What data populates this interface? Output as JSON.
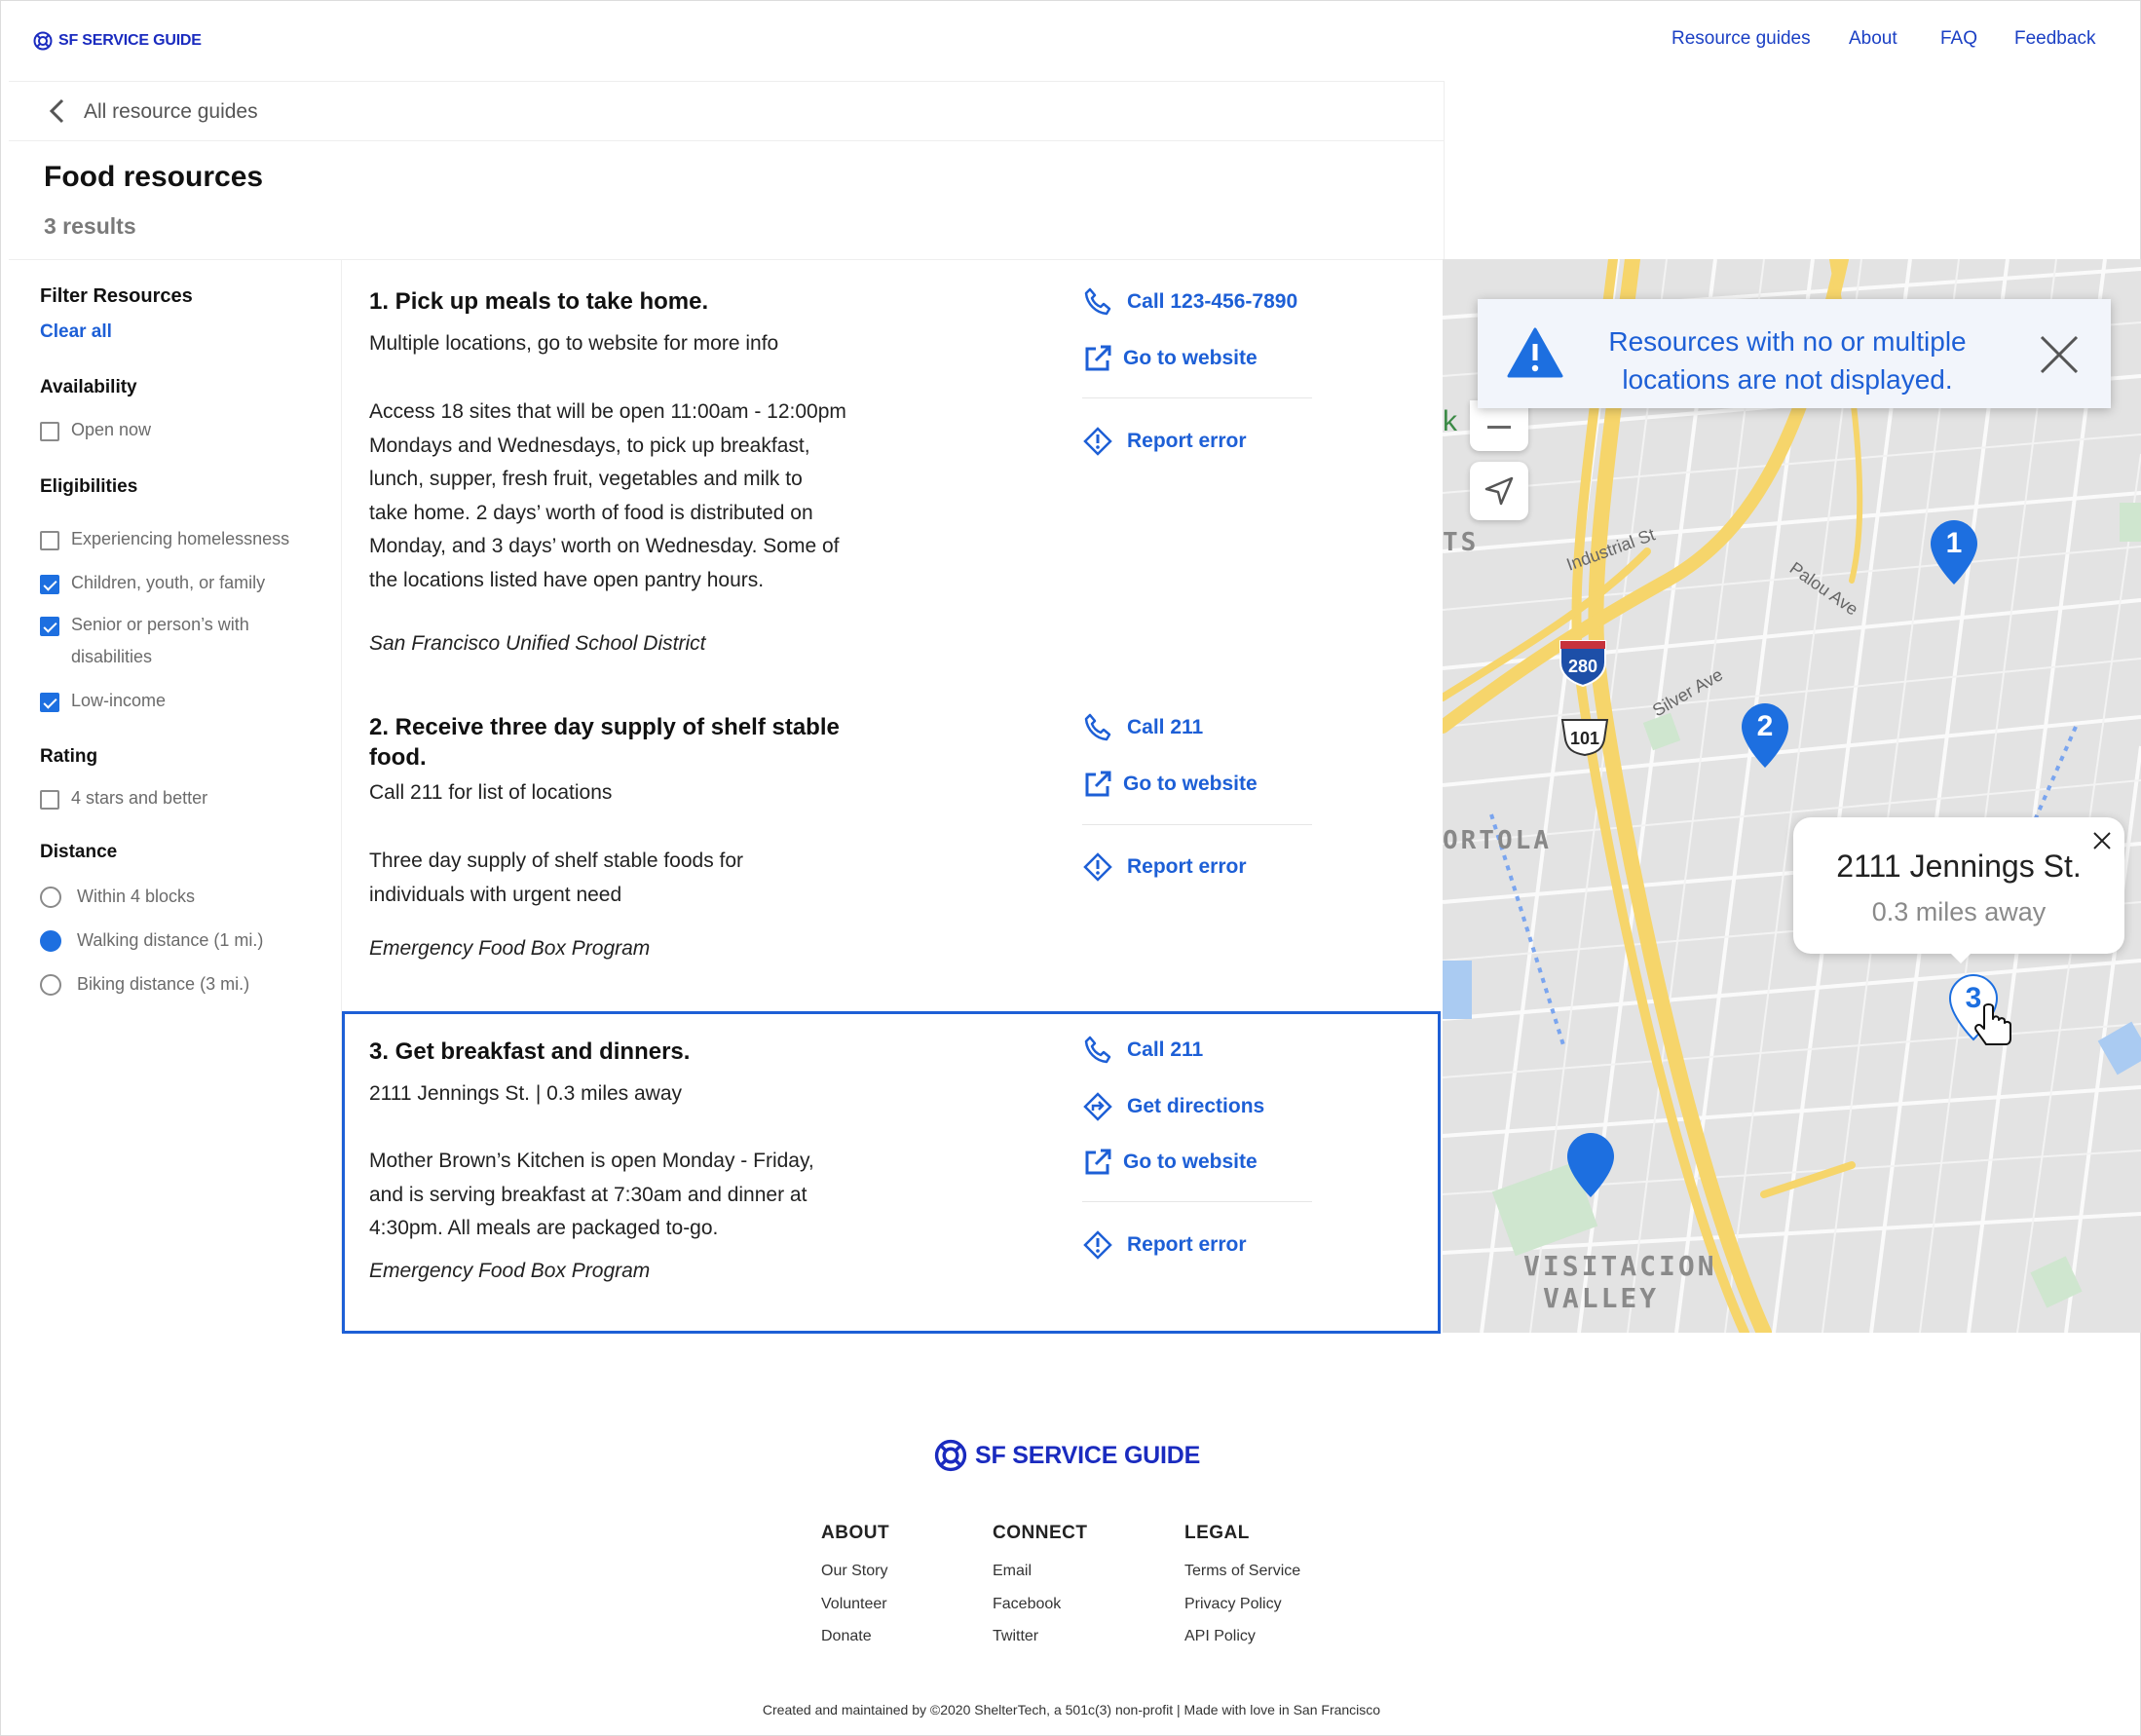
{
  "nav": {
    "logo_text": "SF SERVICE GUIDE",
    "links": [
      "Resource guides",
      "About",
      "FAQ",
      "Feedback"
    ]
  },
  "header": {
    "back_label": "All resource guides",
    "title": "Food resources",
    "count": "3 results"
  },
  "filters": {
    "title": "Filter Resources",
    "clear_all": "Clear all",
    "availability": {
      "heading": "Availability",
      "options": [
        {
          "label": "Open now",
          "checked": false
        }
      ]
    },
    "eligibilities": {
      "heading": "Eligibilities",
      "options": [
        {
          "label": "Experiencing homelessness",
          "checked": false
        },
        {
          "label": "Children, youth, or family",
          "checked": true
        },
        {
          "label": "Senior or person’s with",
          "label2": "disabilities",
          "checked": true
        },
        {
          "label": "Low-income",
          "checked": true
        }
      ]
    },
    "rating": {
      "heading": "Rating",
      "options": [
        {
          "label": "4 stars and better",
          "checked": false
        }
      ]
    },
    "distance": {
      "heading": "Distance",
      "options": [
        {
          "label": "Within 4 blocks",
          "selected": false
        },
        {
          "label": "Walking distance (1 mi.)",
          "selected": true
        },
        {
          "label": "Biking distance (3 mi.)",
          "selected": false
        }
      ]
    }
  },
  "results": [
    {
      "title": "1. Pick up meals to take home.",
      "subtitle": "Multiple locations, go to website for more info",
      "description": [
        "Access 18 sites that will be open 11:00am - 12:00pm",
        "Mondays and Wednesdays, to pick up breakfast,",
        "lunch, supper, fresh fruit, vegetables and milk to",
        "take home. 2 days’ worth of food is distributed on",
        "Monday, and 3 days’ worth on Wednesday. Some of",
        "the locations listed have open pantry hours."
      ],
      "org": "San Francisco Unified School District",
      "call": "Call 123-456-7890",
      "website": "Go to website",
      "report": "Report error"
    },
    {
      "title": [
        "2. Receive three day supply of shelf stable",
        "food."
      ],
      "subtitle": "Call 211 for list of locations",
      "description": [
        "Three day supply of shelf stable foods for",
        "individuals with urgent need"
      ],
      "org": "Emergency Food Box Program",
      "call": "Call 211",
      "website": "Go to website",
      "report": "Report error"
    },
    {
      "title": "3. Get breakfast and dinners.",
      "subtitle": "2111 Jennings St. | 0.3 miles away",
      "description": [
        "Mother Brown’s Kitchen is open Monday - Friday,",
        "and is serving breakfast at 7:30am and dinner at",
        "4:30pm. All meals are packaged to-go."
      ],
      "org": "Emergency Food Box Program",
      "call": "Call 211",
      "directions": "Get directions",
      "website": "Go to website",
      "report": "Report error"
    }
  ],
  "map": {
    "banner_lines": [
      "Resources with no or multiple",
      "locations are not displayed."
    ],
    "popup_address": "2111 Jennings St.",
    "popup_distance": "0.3 miles away",
    "markers": [
      "1",
      "2",
      "3"
    ],
    "labels": {
      "industrial": "Industrial St",
      "palou": "Palou Ave",
      "silver": "Silver Ave",
      "portola": "ORTOLA",
      "visitacion1": "VISITACION",
      "visitacion2": "VALLEY",
      "ts": "TS",
      "k": "k",
      "i280": "280",
      "us101": "101"
    }
  },
  "footer": {
    "logo_text": "SF SERVICE GUIDE",
    "about": {
      "heading": "ABOUT",
      "links": [
        "Our Story",
        "Volunteer",
        "Donate"
      ]
    },
    "connect": {
      "heading": "CONNECT",
      "links": [
        "Email",
        "Facebook",
        "Twitter"
      ]
    },
    "legal": {
      "heading": "LEGAL",
      "links": [
        "Terms of Service",
        "Privacy Policy",
        "API Policy"
      ]
    },
    "copyright": "Created and maintained by ©2020 ShelterTech, a 501c(3) non-profit | Made with love in San Francisco"
  },
  "colors": {
    "accent": "#1d5fd6",
    "brand": "#1a2bbf",
    "map_road": "#f6d56b",
    "map_bg": "#e5e5e5"
  }
}
